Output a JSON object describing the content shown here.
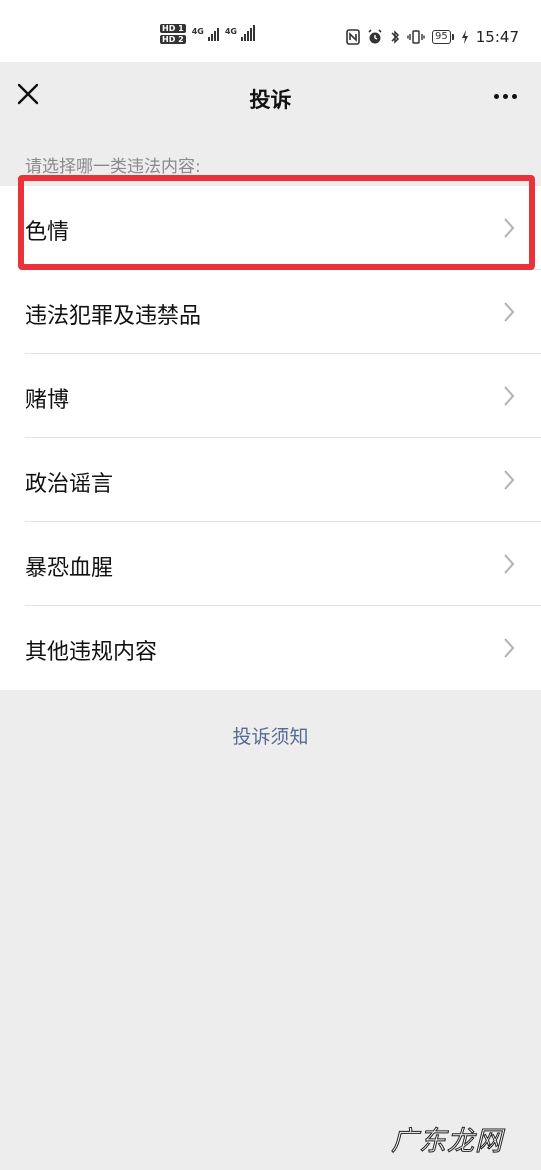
{
  "status_bar": {
    "hd1": "HD 1",
    "hd2": "HD 2",
    "net1": "4G",
    "net2": "4G",
    "battery": "95",
    "time": "15:47"
  },
  "nav": {
    "title": "投诉"
  },
  "prompt": "请选择哪一类违法内容:",
  "items": [
    {
      "label": "色情"
    },
    {
      "label": "违法犯罪及违禁品"
    },
    {
      "label": "赌博"
    },
    {
      "label": "政治谣言"
    },
    {
      "label": "暴恐血腥"
    },
    {
      "label": "其他违规内容"
    }
  ],
  "footer_link": "投诉须知",
  "watermark": "广东龙网",
  "colors": {
    "highlight": "#e9323a",
    "link": "#576b95",
    "background": "#ededed"
  }
}
